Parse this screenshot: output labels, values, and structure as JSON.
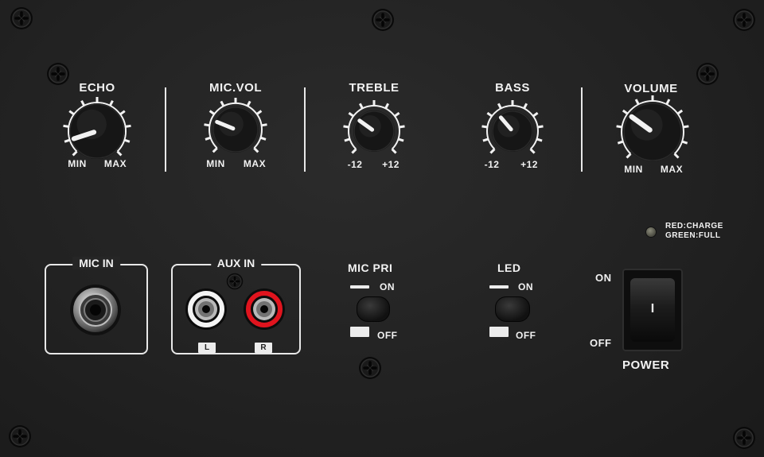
{
  "knobs": [
    {
      "title": "ECHO",
      "min_label": "MIN",
      "max_label": "MAX",
      "level": 0.1
    },
    {
      "title": "MIC.VOL",
      "min_label": "MIN",
      "max_label": "MAX",
      "level": 0.25
    },
    {
      "title": "TREBLE",
      "min_label": "-12",
      "max_label": "+12",
      "level": 0.3
    },
    {
      "title": "BASS",
      "min_label": "-12",
      "max_label": "+12",
      "level": 0.35
    },
    {
      "title": "VOLUME",
      "min_label": "MIN",
      "max_label": "MAX",
      "level": 0.3
    }
  ],
  "mic_in": {
    "title": "MIC IN"
  },
  "aux_in": {
    "title": "AUX IN",
    "left_label": "L",
    "right_label": "R"
  },
  "mic_pri": {
    "title": "MIC PRI",
    "on_label": "ON",
    "off_label": "OFF"
  },
  "led": {
    "title": "LED",
    "on_label": "ON",
    "off_label": "OFF"
  },
  "charge_indicator": {
    "line1": "RED:CHARGE",
    "line2": "GREEN:FULL"
  },
  "power": {
    "title": "POWER",
    "on_label": "ON",
    "off_label": "OFF",
    "switch_mark": "I"
  },
  "colors": {
    "panel": "#222222",
    "print": "#f2f2f2",
    "rca_left_ring": "#f4f4f4",
    "rca_right_ring": "#e0141e"
  }
}
